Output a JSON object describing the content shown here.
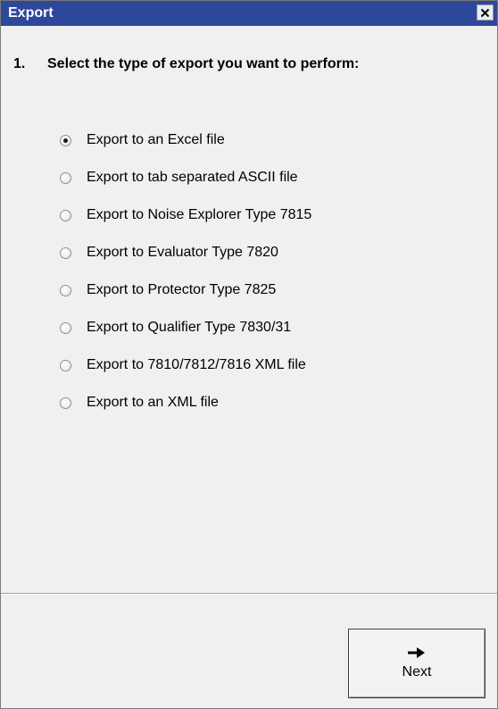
{
  "window": {
    "title": "Export",
    "close_icon": "close-icon",
    "title_bar_color": "#2d479b"
  },
  "step": {
    "number": "1.",
    "heading": "Select the type of export you want to perform:"
  },
  "options": [
    {
      "label": "Export to an Excel file",
      "selected": true
    },
    {
      "label": "Export to tab separated ASCII file",
      "selected": false
    },
    {
      "label": "Export to Noise Explorer Type 7815",
      "selected": false
    },
    {
      "label": "Export to Evaluator Type 7820",
      "selected": false
    },
    {
      "label": "Export to Protector Type 7825",
      "selected": false
    },
    {
      "label": "Export to Qualifier Type 7830/31",
      "selected": false
    },
    {
      "label": "Export to 7810/7812/7816 XML file",
      "selected": false
    },
    {
      "label": "Export to an XML file",
      "selected": false
    }
  ],
  "buttons": {
    "next_label": "Next",
    "next_icon": "arrow-right-icon"
  }
}
